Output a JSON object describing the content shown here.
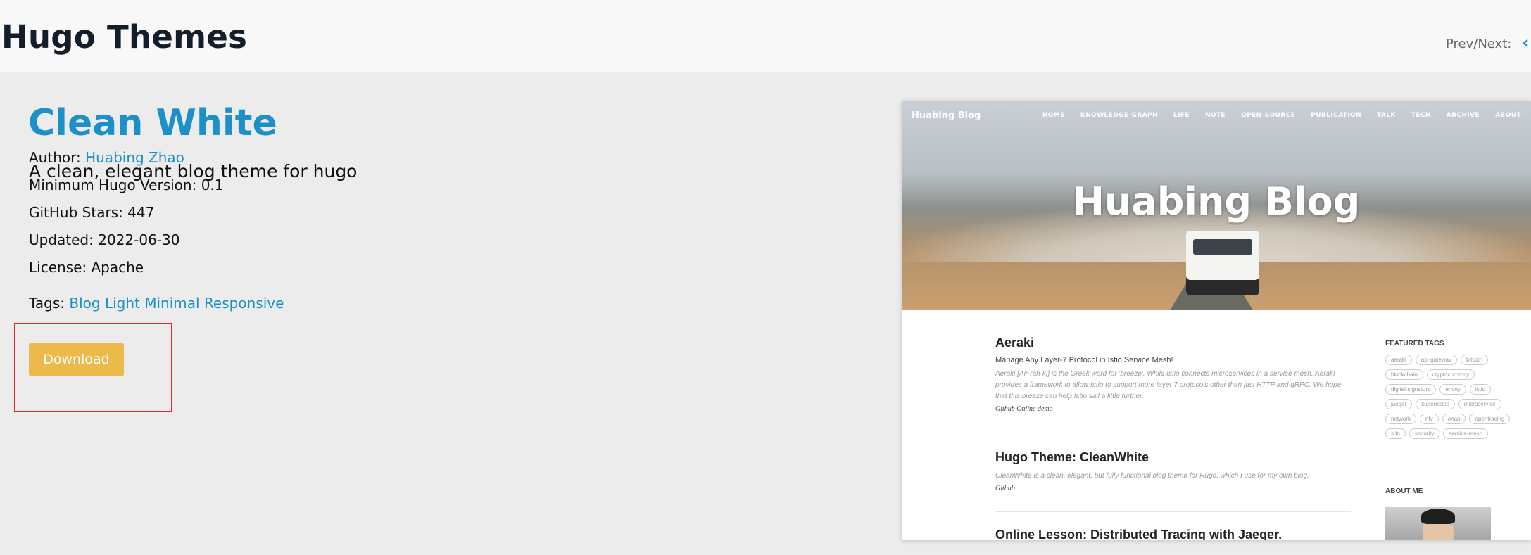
{
  "header": {
    "site_title": "Hugo Themes",
    "prev_next_label": "Prev/Next:",
    "prev_arrow": "‹"
  },
  "theme": {
    "name": "Clean White",
    "description": "A clean, elegant blog theme for hugo",
    "author_label": "Author:",
    "author_name": "Huabing Zhao",
    "min_version": "Minimum Hugo Version: 0.1",
    "stars": "GitHub Stars: 447",
    "updated": "Updated: 2022-06-30",
    "license": "License: Apache",
    "tags_label": "Tags:",
    "tags": [
      "Blog",
      "Light",
      "Minimal",
      "Responsive"
    ],
    "download_label": "Download"
  },
  "preview": {
    "brand": "Huabing Blog",
    "menu": [
      "HOME",
      "KNOWLEDGE-GRAPH",
      "LIFE",
      "NOTE",
      "OPEN-SOURCE",
      "PUBLICATION",
      "TALK",
      "TECH",
      "ARCHIVE",
      "ABOUT"
    ],
    "hero_title": "Huabing Blog",
    "posts": [
      {
        "title": "Aeraki",
        "subtitle": "Manage Any Layer-7 Protocol in Istio Service Mesh!",
        "excerpt": "Aeraki [Air-rah-ki] is the Greek word for 'breeze'. While Istio connects microservices in a service mesh, Aeraki provides a framework to allow Istio to support more layer 7 protocols other than just HTTP and gRPC. We hope that this breeze can help Istio sail a little further.",
        "links": "Github Online demo"
      },
      {
        "title": "Hugo Theme: CleanWhite",
        "subtitle": "",
        "excerpt": "CleanWhite is a clean, elegant, but fully functional blog theme for Hugo, which I use for my own blog.",
        "links": "Github"
      },
      {
        "title": "Online Lesson: Distributed Tracing with Jaeger.",
        "subtitle": "",
        "excerpt": "",
        "links": ""
      }
    ],
    "featured_tags_heading": "FEATURED TAGS",
    "featured_tags": [
      "aeraki",
      "api-gateway",
      "bitcoin",
      "blockchain",
      "cryptocurrency",
      "digital-signature",
      "envoy",
      "istio",
      "jaeger",
      "kubernetes",
      "microservice",
      "network",
      "nfv",
      "onap",
      "opentracing",
      "sdn",
      "security",
      "service-mesh"
    ],
    "about_heading": "ABOUT ME"
  },
  "colors": {
    "link": "#1d90c7",
    "download_button": "#ebba4a",
    "highlight_box": "#e0272b"
  }
}
